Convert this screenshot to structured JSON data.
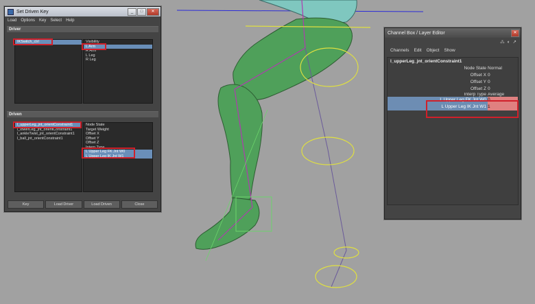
{
  "set_driven_key": {
    "title": "Set Driven Key",
    "menu": [
      "Load",
      "Options",
      "Key",
      "Select",
      "Help"
    ],
    "driver_section": "Driver",
    "driver_objects": [
      "IKSwitch_ctrl"
    ],
    "driver_attributes": [
      "Visibility",
      "L Arm",
      "R Arm",
      "L Leg",
      "R Leg"
    ],
    "driven_section": "Driven",
    "driven_objects": [
      "l_upperLeg_jnt_orientConstraint1",
      "l_lowerLeg_jnt_orientConstraint1",
      "l_ankleTwist_jnt_orientConstraint1",
      "l_ball_jnt_orientConstraint1"
    ],
    "driven_attributes": [
      "Node State",
      "Target Weight",
      "Offset X",
      "Offset Y",
      "Offset Z",
      "Interp Type",
      "L Upper Leg FK Jnt W0",
      "L Upper Leg IK Jnt W1"
    ],
    "buttons": {
      "key": "Key",
      "load_driver": "Load Driver",
      "load_driven": "Load Driven",
      "close": "Close"
    }
  },
  "channel_box": {
    "title": "Channel Box / Layer Editor",
    "menu": [
      "Channels",
      "Edit",
      "Object",
      "Show"
    ],
    "object_name": "l_upperLeg_jnt_orientConstraint1",
    "channels": [
      {
        "name": "Node State",
        "value": "Normal"
      },
      {
        "name": "Offset X",
        "value": "0"
      },
      {
        "name": "Offset Y",
        "value": "0"
      },
      {
        "name": "Offset Z",
        "value": "0"
      },
      {
        "name": "Interp Type",
        "value": "Average"
      },
      {
        "name": "L Upper Leg FK Jnt W0",
        "value": "0"
      },
      {
        "name": "L Upper Leg IK Jnt W1",
        "value": "1"
      }
    ]
  }
}
